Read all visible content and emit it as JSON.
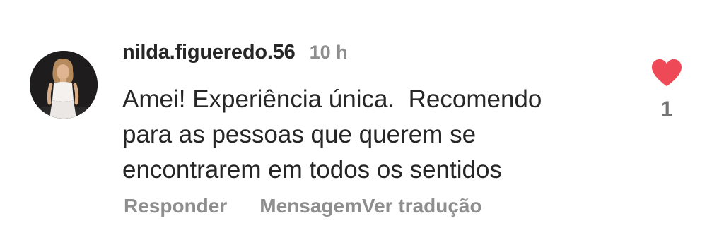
{
  "comment": {
    "username": "nilda.figueredo.56",
    "timestamp": "10 h",
    "text_lines": [
      "Amei! Experiência única.  Recomendo",
      "para as pessoas que querem se",
      "encontrarem em todos os sentidos"
    ],
    "avatar_icon": "profile-photo",
    "like_icon": "heart-icon",
    "like_color": "#ed4956",
    "liked": true,
    "like_count": "1"
  },
  "actions": {
    "reply_label": "Responder",
    "message_label": "Mensagem",
    "translate_label": "Ver tradução"
  }
}
